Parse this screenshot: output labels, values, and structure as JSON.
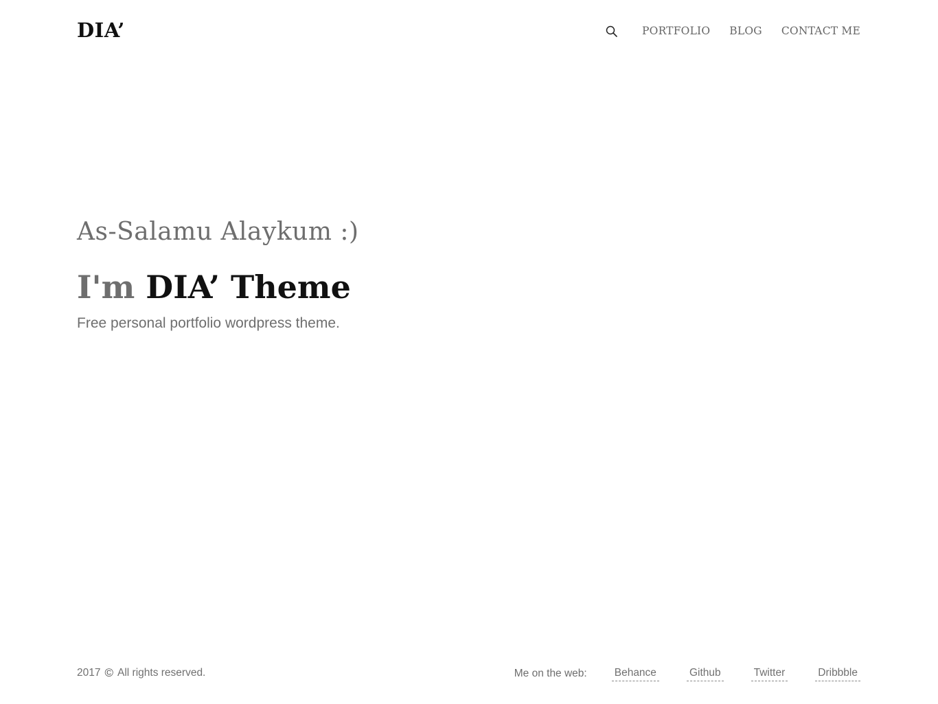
{
  "header": {
    "logo": "DIA’",
    "nav": [
      "PORTFOLIO",
      "BLOG",
      "CONTACT ME"
    ],
    "search_icon": "search-icon"
  },
  "hero": {
    "greeting": "As-Salamu Alaykum :)",
    "headline_prefix": "I'm",
    "headline_name": "DIA’ Theme",
    "tagline": "Free personal portfolio wordpress theme."
  },
  "footer": {
    "year": "2017",
    "copyright_icon": "copyright-icon",
    "rights": "All rights reserved.",
    "web_label": "Me on the web:",
    "links": [
      "Behance",
      "Github",
      "Twitter",
      "Dribbble"
    ]
  }
}
